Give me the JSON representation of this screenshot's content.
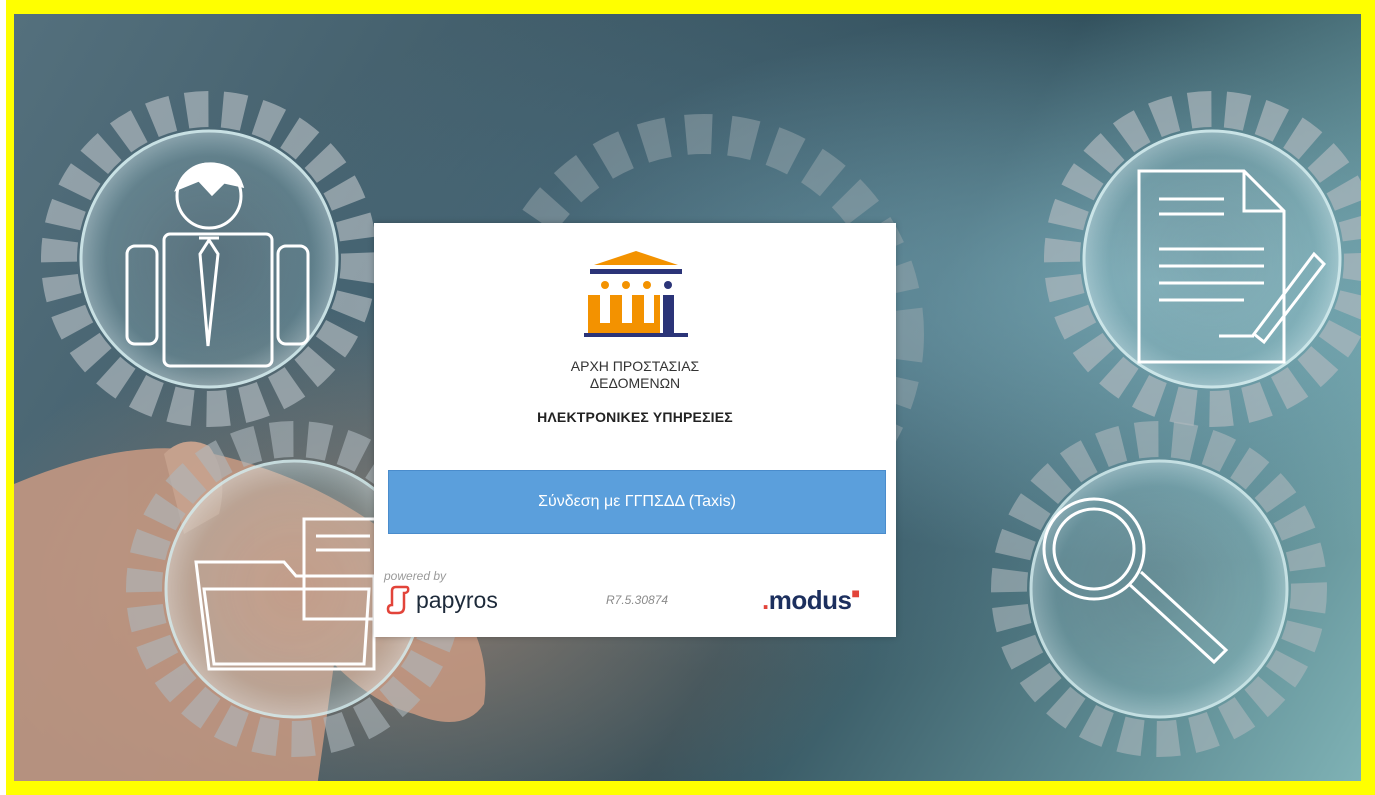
{
  "org": {
    "name": "ΑΡΧΗ ΠΡΟΣΤΑΣΙΑΣ\nΔΕΔΟΜΕΝΩΝ",
    "services_title": "ΗΛΕΚΤΡΟΝΙΚΕΣ ΥΠΗΡΕΣΙΕΣ"
  },
  "login": {
    "button_label": "Σύνδεση με ΓΓΠΣΔΔ (Taxis)"
  },
  "footer": {
    "powered_by": "powered by",
    "papyros": "papyros",
    "version": "R7.5.30874",
    "modus": "modus"
  },
  "colors": {
    "frame": "#ffff00",
    "button": "#5b9fdc",
    "logo_orange": "#f39200",
    "logo_navy": "#2b3478",
    "papyros_red": "#e2443a",
    "modus_navy": "#1c2f5e"
  },
  "icons": [
    "user-icon",
    "document-edit-icon",
    "folder-icon",
    "magnifier-icon",
    "gear-icon"
  ]
}
